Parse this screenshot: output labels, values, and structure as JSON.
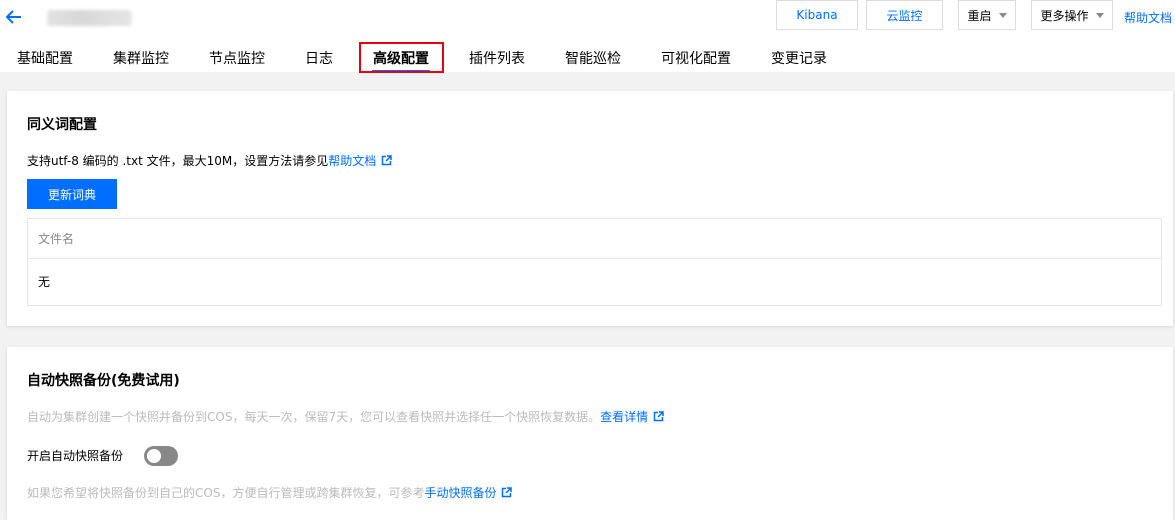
{
  "header": {
    "kibana_label": "Kibana",
    "cloud_monitor_label": "云监控",
    "restart_label": "重启",
    "more_actions_label": "更多操作",
    "help_docs_label": "帮助文档"
  },
  "tabs": [
    {
      "label": "基础配置"
    },
    {
      "label": "集群监控"
    },
    {
      "label": "节点监控"
    },
    {
      "label": "日志"
    },
    {
      "label": "高级配置",
      "active": true
    },
    {
      "label": "插件列表"
    },
    {
      "label": "智能巡检"
    },
    {
      "label": "可视化配置"
    },
    {
      "label": "变更记录"
    }
  ],
  "synonym": {
    "title": "同义词配置",
    "desc_prefix": "支持utf-8 编码的 .txt 文件，最大10M，设置方法请参见",
    "help_link": "帮助文档",
    "update_button": "更新词典",
    "table": {
      "column_filename": "文件名",
      "empty_value": "无"
    }
  },
  "snapshot": {
    "title": "自动快照备份(免费试用)",
    "desc_prefix": "自动为集群创建一个快照并备份到COS，每天一次，保留7天，您可以查看快照并选择任一个快照恢复数据。",
    "details_link": "查看详情",
    "toggle_label": "开启自动快照备份",
    "toggle_on": false,
    "manual_prefix": "如果您希望将快照备份到自己的COS，方便自行管理或跨集群恢复，可参考",
    "manual_link": "手动快照备份"
  },
  "colors": {
    "primary": "#006eff",
    "highlight_border": "#e60012"
  },
  "icons": [
    "back-arrow-icon",
    "dropdown-caret-icon",
    "external-link-icon"
  ]
}
